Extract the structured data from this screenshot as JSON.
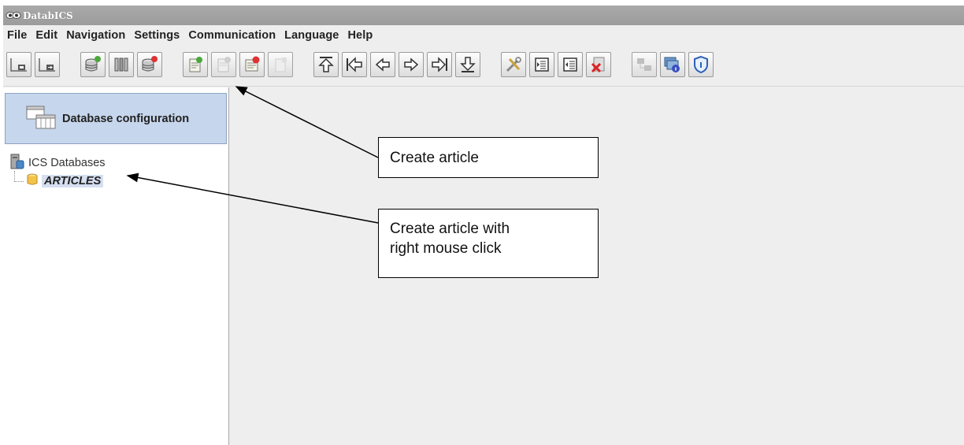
{
  "window": {
    "title": "DatabICS"
  },
  "menu": {
    "items": [
      "File",
      "Edit",
      "Navigation",
      "Settings",
      "Communication",
      "Language",
      "Help"
    ]
  },
  "toolbar": {
    "buttons": [
      {
        "icon": "connect-icon"
      },
      {
        "icon": "disconnect-icon"
      },
      {
        "icon": "database-add-icon"
      },
      {
        "icon": "database-columns-icon"
      },
      {
        "icon": "database-delete-icon"
      },
      {
        "icon": "create-article-icon"
      },
      {
        "icon": "edit-article-icon"
      },
      {
        "icon": "delete-article-icon"
      },
      {
        "icon": "article-disabled-icon"
      },
      {
        "icon": "first-record-icon"
      },
      {
        "icon": "previous-page-icon"
      },
      {
        "icon": "previous-record-icon"
      },
      {
        "icon": "next-record-icon"
      },
      {
        "icon": "next-page-icon"
      },
      {
        "icon": "last-record-icon"
      },
      {
        "icon": "tools-icon"
      },
      {
        "icon": "import-icon"
      },
      {
        "icon": "export-icon"
      },
      {
        "icon": "delete-file-icon"
      },
      {
        "icon": "network-icon"
      },
      {
        "icon": "window-info-icon"
      },
      {
        "icon": "shield-icon"
      }
    ]
  },
  "sidebar": {
    "config_button_label": "Database configuration",
    "tree": {
      "root_label": "ICS Databases",
      "children": [
        {
          "label": "ARTICLES"
        }
      ]
    }
  },
  "annotations": {
    "create_article": "Create article",
    "create_article_right_click_line1": "Create article with",
    "create_article_right_click_line2": "right mouse click"
  }
}
